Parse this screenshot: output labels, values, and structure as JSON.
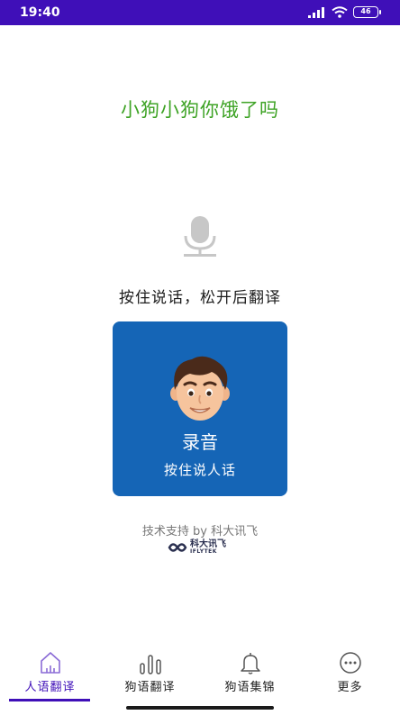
{
  "status_bar": {
    "time": "19:40",
    "battery": "46"
  },
  "main": {
    "result_text": "小狗小狗你饿了吗",
    "mic_icon": "microphone-icon",
    "hint": "按住说话，松开后翻译",
    "record_button": {
      "title": "录音",
      "subtitle": "按住说人话"
    }
  },
  "footer": {
    "powered_by": "技术支持 by 科大讯飞",
    "brand_cn": "科大讯飞",
    "brand_en": "IFLYTEK"
  },
  "tabs": [
    {
      "label": "人语翻译",
      "icon": "home-icon",
      "active": true
    },
    {
      "label": "狗语翻译",
      "icon": "sound-bars-icon",
      "active": false
    },
    {
      "label": "狗语集锦",
      "icon": "bell-icon",
      "active": false
    },
    {
      "label": "更多",
      "icon": "more-icon",
      "active": false
    }
  ],
  "colors": {
    "accent": "#3f0fb8",
    "result_green": "#3ea325",
    "record_blue": "#1565b6"
  }
}
